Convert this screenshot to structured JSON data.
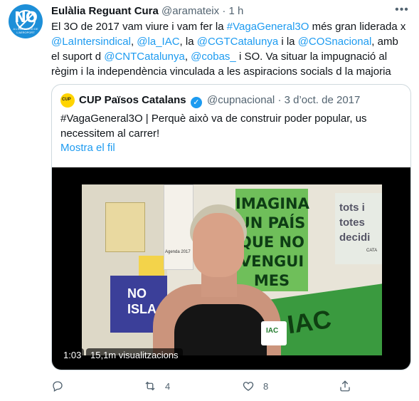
{
  "tweet": {
    "avatar": {
      "text": "NO",
      "subtext": "A L'AMPLIACIÓ DE L'AEROPORT"
    },
    "author_name": "Eulàlia Reguant Cura",
    "author_handle": "@aramateix",
    "dot": "·",
    "time": "1 h",
    "text_parts": [
      {
        "text": "El 3O de 2017 vam viure i vam fer la ",
        "type": "text"
      },
      {
        "text": "#VagaGeneral3O",
        "type": "link"
      },
      {
        "text": " més gran liderada x ",
        "type": "text"
      },
      {
        "text": "@LaIntersindical",
        "type": "link"
      },
      {
        "text": ", ",
        "type": "text"
      },
      {
        "text": "@la_IAC",
        "type": "link"
      },
      {
        "text": ", la ",
        "type": "text"
      },
      {
        "text": "@CGTCatalunya",
        "type": "link"
      },
      {
        "text": " i la ",
        "type": "text"
      },
      {
        "text": "@COSnacional",
        "type": "link"
      },
      {
        "text": ", amb el suport d ",
        "type": "text"
      },
      {
        "text": "@CNTCatalunya",
        "type": "link"
      },
      {
        "text": ", ",
        "type": "text"
      },
      {
        "text": "@cobas_",
        "type": "link"
      },
      {
        "text": " i SO. Va situar la impugnació al règim i la independència vinculada a les aspiracions socials d la majoria",
        "type": "text"
      }
    ]
  },
  "quote": {
    "avatar_text": "CUP",
    "author_name": "CUP Països Catalans",
    "verified_glyph": "✓",
    "author_handle": "@cupnacional",
    "dot": "·",
    "date": "3 d’oct. de 2017",
    "text": "#VagaGeneral3O | Perquè això va de construir poder popular, us necessitem al carrer!",
    "show_thread": "Mostra el fil",
    "video": {
      "duration": "1:03",
      "views": "15,1m visualitzacions",
      "scene": {
        "green_sign": "IMAGINA UN PAÍS QUE NO VENGUI MES",
        "blue_sign": "NO ISLA",
        "right_sign": "tots i totes decidi",
        "right_sign_small": "CATA",
        "banner": "IAC",
        "badge": "IAC",
        "calendar": "Agenda 2017"
      }
    }
  },
  "actions": {
    "reply_count": "",
    "retweet_count": "4",
    "like_count": "8",
    "share_count": ""
  },
  "colors": {
    "link": "#1d9bf0",
    "secondary_text": "#536471",
    "border": "#cfd9de"
  }
}
